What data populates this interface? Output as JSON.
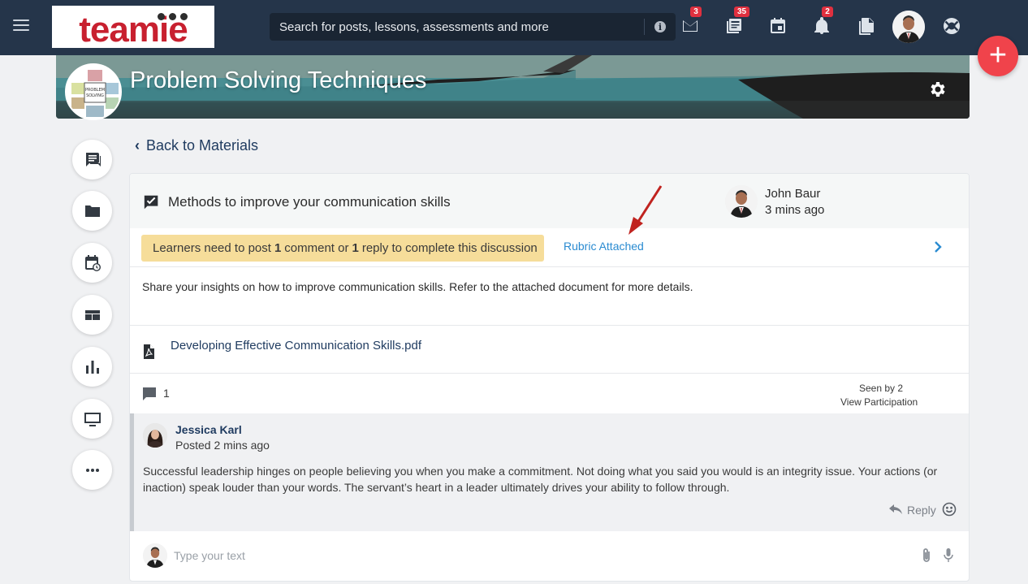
{
  "brand": {
    "logo_text": "teamie",
    "logo_color": "#c8202f"
  },
  "topbar": {
    "search_placeholder": "Search for posts, lessons, assessments and more",
    "icons": [
      {
        "name": "mail-icon",
        "badge": "3"
      },
      {
        "name": "newsfeed-icon",
        "badge": "35"
      },
      {
        "name": "calendar-icon",
        "badge": ""
      },
      {
        "name": "bell-icon",
        "badge": "2"
      },
      {
        "name": "documents-icon",
        "badge": ""
      },
      {
        "name": "help-lifebuoy-icon",
        "badge": ""
      }
    ],
    "fab_label": "+"
  },
  "course": {
    "title": "Problem Solving Techniques"
  },
  "rail": [
    "discussions-icon",
    "folder-icon",
    "schedule-icon",
    "dashboard-icon",
    "analytics-icon",
    "screen-icon",
    "more-icon"
  ],
  "nav": {
    "back_label": "Back to Materials",
    "back_chevron": "‹"
  },
  "discussion": {
    "title": "Methods to improve your communication skills",
    "author": "John Baur",
    "time": "3 mins ago",
    "requirement_pre": "Learners need to post",
    "requirement_n1": "1",
    "requirement_mid": "comment or",
    "requirement_n2": "1",
    "requirement_post": "reply to complete this discussion",
    "rubric_link": "Rubric Attached",
    "description": "Share your insights on how to improve communication skills. Refer to the attached document for more details.",
    "attachment": "Developing Effective Communication Skills.pdf",
    "comment_count": "1",
    "seen_by": "Seen by 2",
    "view_participation": "View Participation"
  },
  "comment": {
    "author": "Jessica Karl",
    "time": "Posted 2 mins ago",
    "body": "Successful leadership hinges on people believing you when you make a commitment. Not doing what you said you would is an integrity issue. Your actions (or inaction) speak louder than your words. The servant’s heart in a leader ultimately drives your ability to follow through.",
    "reply_label": "Reply"
  },
  "compose": {
    "placeholder": "Type your text"
  },
  "colors": {
    "topbar": "#25354a",
    "accent_link": "#2a8bd1",
    "requirement_bg": "#f6dd9a",
    "fab": "#f0434b",
    "badge": "#e0303f",
    "annotation_arrow": "#c0231f"
  }
}
